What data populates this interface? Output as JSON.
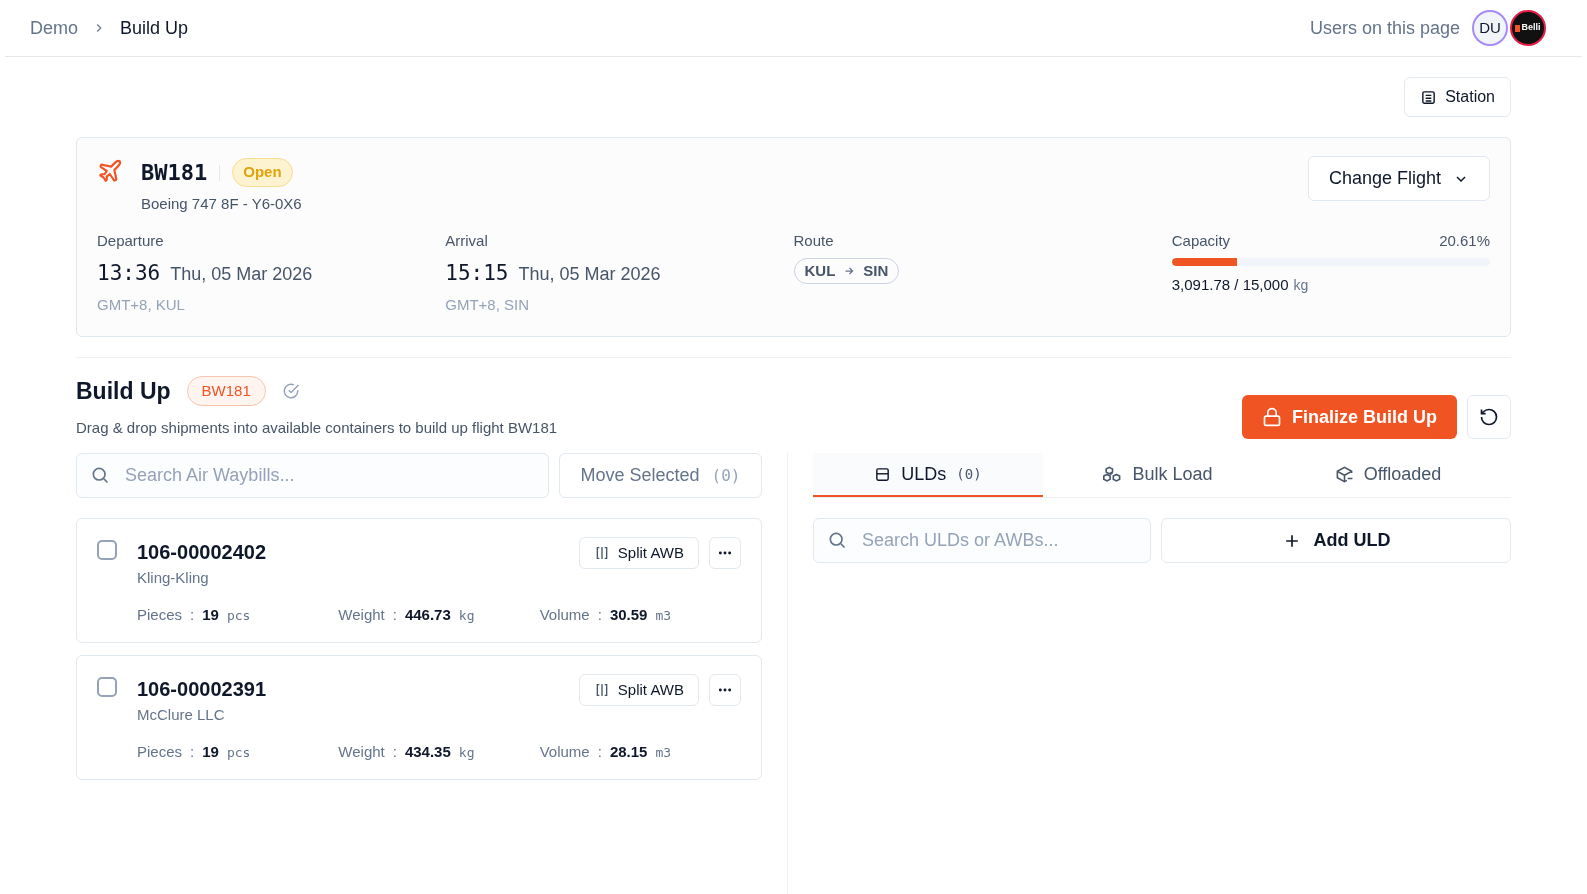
{
  "breadcrumb": [
    {
      "label": "Demo"
    },
    {
      "label": "Build Up"
    }
  ],
  "presence": {
    "label": "Users on this page",
    "users": [
      {
        "kind": "initials",
        "text": "DU",
        "color": "#a78bfa"
      },
      {
        "kind": "logo",
        "text": "Belli",
        "color": "#e11d48"
      }
    ]
  },
  "station_button": "Station",
  "flight": {
    "number": "BW181",
    "status": "Open",
    "aircraft": "Boeing 747 8F - Y6-0X6",
    "change_button": "Change Flight",
    "departure": {
      "label": "Departure",
      "time": "13:36",
      "date": "Thu, 05 Mar 2026",
      "zone": "GMT+8, KUL"
    },
    "arrival": {
      "label": "Arrival",
      "time": "15:15",
      "date": "Thu, 05 Mar 2026",
      "zone": "GMT+8, SIN"
    },
    "route": {
      "label": "Route",
      "from": "KUL",
      "to": "SIN"
    },
    "capacity": {
      "label": "Capacity",
      "percent": "20.61%",
      "level": 0.2061,
      "used": "3,091.78 / 15,000",
      "unit": "kg"
    }
  },
  "build_up": {
    "title": "Build Up",
    "badge": "BW181",
    "description": "Drag & drop shipments into available containers to build up flight BW181",
    "finalize_button": "Finalize Build Up",
    "search_placeholder": "Search Air Waybills...",
    "move_selected": {
      "label": "Move Selected",
      "count": "(0)"
    },
    "shipments": [
      {
        "awb": "106-00002402",
        "company": "Kling-Kling",
        "checked": false,
        "split_button": "Split AWB",
        "fields": [
          {
            "label": "Pieces",
            "separator": ":",
            "value": "19",
            "unit": "pcs"
          },
          {
            "label": "Weight",
            "separator": ":",
            "value": "446.73",
            "unit": "kg"
          },
          {
            "label": "Volume",
            "separator": ":",
            "value": "30.59",
            "unit": "m3"
          }
        ]
      },
      {
        "awb": "106-00002391",
        "company": "McClure LLC",
        "checked": false,
        "split_button": "Split AWB",
        "fields": [
          {
            "label": "Pieces",
            "separator": ":",
            "value": "19",
            "unit": "pcs"
          },
          {
            "label": "Weight",
            "separator": ":",
            "value": "434.35",
            "unit": "kg"
          },
          {
            "label": "Volume",
            "separator": ":",
            "value": "28.15",
            "unit": "m3"
          }
        ]
      }
    ],
    "tabs": [
      {
        "kind": "uld",
        "label": "ULDs",
        "count": "(0)",
        "selected": true
      },
      {
        "kind": "bulk",
        "label": "Bulk Load",
        "selected": false
      },
      {
        "kind": "offloaded",
        "label": "Offloaded",
        "selected": false
      }
    ],
    "uld_search_placeholder": "Search ULDs or AWBs...",
    "add_uld_button": "Add ULD"
  }
}
